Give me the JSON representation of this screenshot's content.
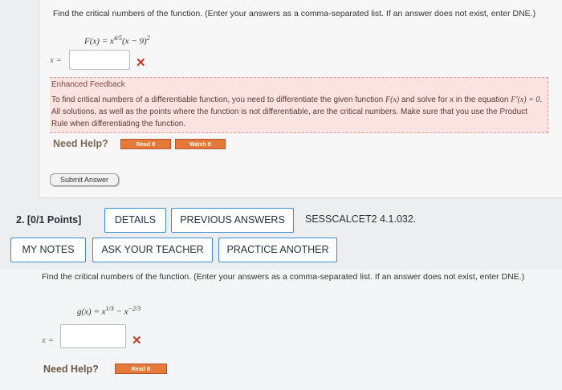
{
  "problem1": {
    "prompt": "Find the critical numbers of the function. (Enter your answers as a comma-separated list. If an answer does not exist, enter DNE.)",
    "function_name": "F(x)",
    "function_rhs_base": "x",
    "function_rhs_exp": "4/5",
    "function_rhs_rest": "(x − 9)",
    "function_rhs_exp2": "2",
    "answer_label": "x =",
    "answer_value": "",
    "answer_status": "incorrect",
    "feedback": {
      "title": "Enhanced Feedback",
      "text_1": "To find critical numbers of a differentiable function, you need to differentiate the given function ",
      "text_f": "F(x)",
      "text_2": " and solve for x in the equation ",
      "text_fp": "F'(x) = 0",
      "text_3": ". All solutions, as well as the points where the function is not differentiable, are the critical numbers. Make sure that you use the Product Rule when differentiating the function."
    },
    "need_help_label": "Need Help?",
    "read_it_label": "Read It",
    "watch_it_label": "Watch It",
    "submit_label": "Submit Answer"
  },
  "question2": {
    "number_label": "2. [0/1 Points]",
    "details_label": "DETAILS",
    "previous_answers_label": "PREVIOUS ANSWERS",
    "course_code": "SESSCALCET2 4.1.032.",
    "my_notes_label": "MY NOTES",
    "ask_teacher_label": "ASK YOUR TEACHER",
    "practice_another_label": "PRACTICE ANOTHER",
    "prompt": "Find the critical numbers of the function. (Enter your answers as a comma-separated list. If an answer does not exist, enter DNE.)",
    "function_name": "g(x)",
    "function_term1_base": "x",
    "function_term1_exp": "1/3",
    "function_minus": " − ",
    "function_term2_base": "x",
    "function_term2_exp": "−2/3",
    "answer_label": "x =",
    "answer_value": "",
    "answer_status": "incorrect",
    "need_help_label": "Need Help?",
    "read_it_label": "Read It"
  },
  "colors": {
    "accent_border": "#3e8bd0",
    "incorrect_mark": "#c0392b",
    "help_button": "#e4793a",
    "feedback_bg": "#fbe3e2"
  }
}
